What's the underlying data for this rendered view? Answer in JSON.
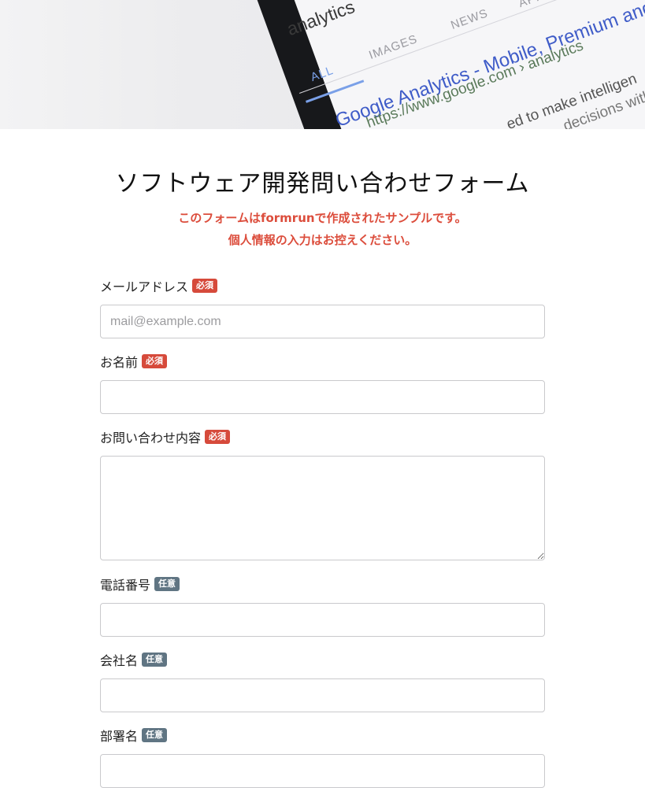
{
  "hero": {
    "query": "analytics",
    "tabs": [
      "ALL",
      "IMAGES",
      "NEWS",
      "APPS"
    ],
    "result_title": "Google Analytics - Mobile, Premium and",
    "result_url": "https://www.google.com › analytics",
    "snippet_1": "ed to make intelligen",
    "snippet_2": "decisions with"
  },
  "form": {
    "title": "ソフトウェア開発問い合わせフォーム",
    "notice_line1": "このフォームはformrunで作成されたサンプルです。",
    "notice_line2": "個人情報の入力はお控えください。",
    "badge_required": "必須",
    "badge_optional": "任意",
    "fields": [
      {
        "label": "メールアドレス",
        "placeholder": "mail@example.com",
        "value": ""
      },
      {
        "label": "お名前",
        "placeholder": "",
        "value": ""
      },
      {
        "label": "お問い合わせ内容",
        "placeholder": "",
        "value": ""
      },
      {
        "label": "電話番号",
        "placeholder": "",
        "value": ""
      },
      {
        "label": "会社名",
        "placeholder": "",
        "value": ""
      },
      {
        "label": "部署名",
        "placeholder": "",
        "value": ""
      }
    ]
  },
  "colors": {
    "required_badge": "#d64a3b",
    "optional_badge": "#607583",
    "notice_text": "#dc4d3c"
  }
}
